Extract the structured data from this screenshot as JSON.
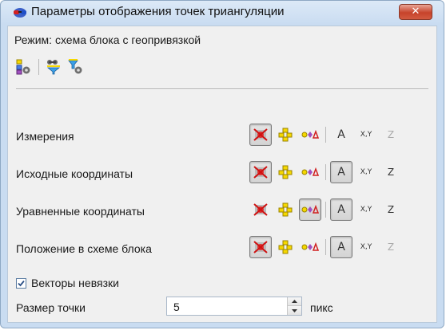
{
  "window": {
    "title": "Параметры отображения точек триангуляции",
    "close_glyph": "✕"
  },
  "mode": {
    "label": "Режим: схема блока с геопривязкой"
  },
  "toolbar": {
    "icons": [
      "points-settings-icon",
      "view-filter-icon",
      "filter-settings-icon"
    ]
  },
  "rows": [
    {
      "label": "Измерения",
      "active": [
        true,
        false,
        false,
        false,
        false,
        false
      ],
      "disabled_z": true
    },
    {
      "label": "Исходные координаты",
      "active": [
        true,
        false,
        false,
        true,
        false,
        false
      ],
      "disabled_z": false
    },
    {
      "label": "Уравненные координаты",
      "active": [
        false,
        false,
        true,
        true,
        false,
        false
      ],
      "disabled_z": false
    },
    {
      "label": "Положение в схеме блока",
      "active": [
        true,
        false,
        false,
        true,
        false,
        false
      ],
      "disabled_z": true
    }
  ],
  "icon_glyphs": {
    "label_a": "A",
    "label_xy": "X,Y",
    "label_z": "Z"
  },
  "residual_vectors": {
    "label": "Векторы невязки",
    "checked": true
  },
  "point_size": {
    "label": "Размер точки",
    "value": "5",
    "unit": "пикс"
  },
  "colors": {
    "title_bg": "#c9dcf1",
    "client_bg": "#f0f0f0",
    "close_red": "#c7432b",
    "accent_yellow": "#f5d800",
    "accent_purple": "#a050c0"
  }
}
